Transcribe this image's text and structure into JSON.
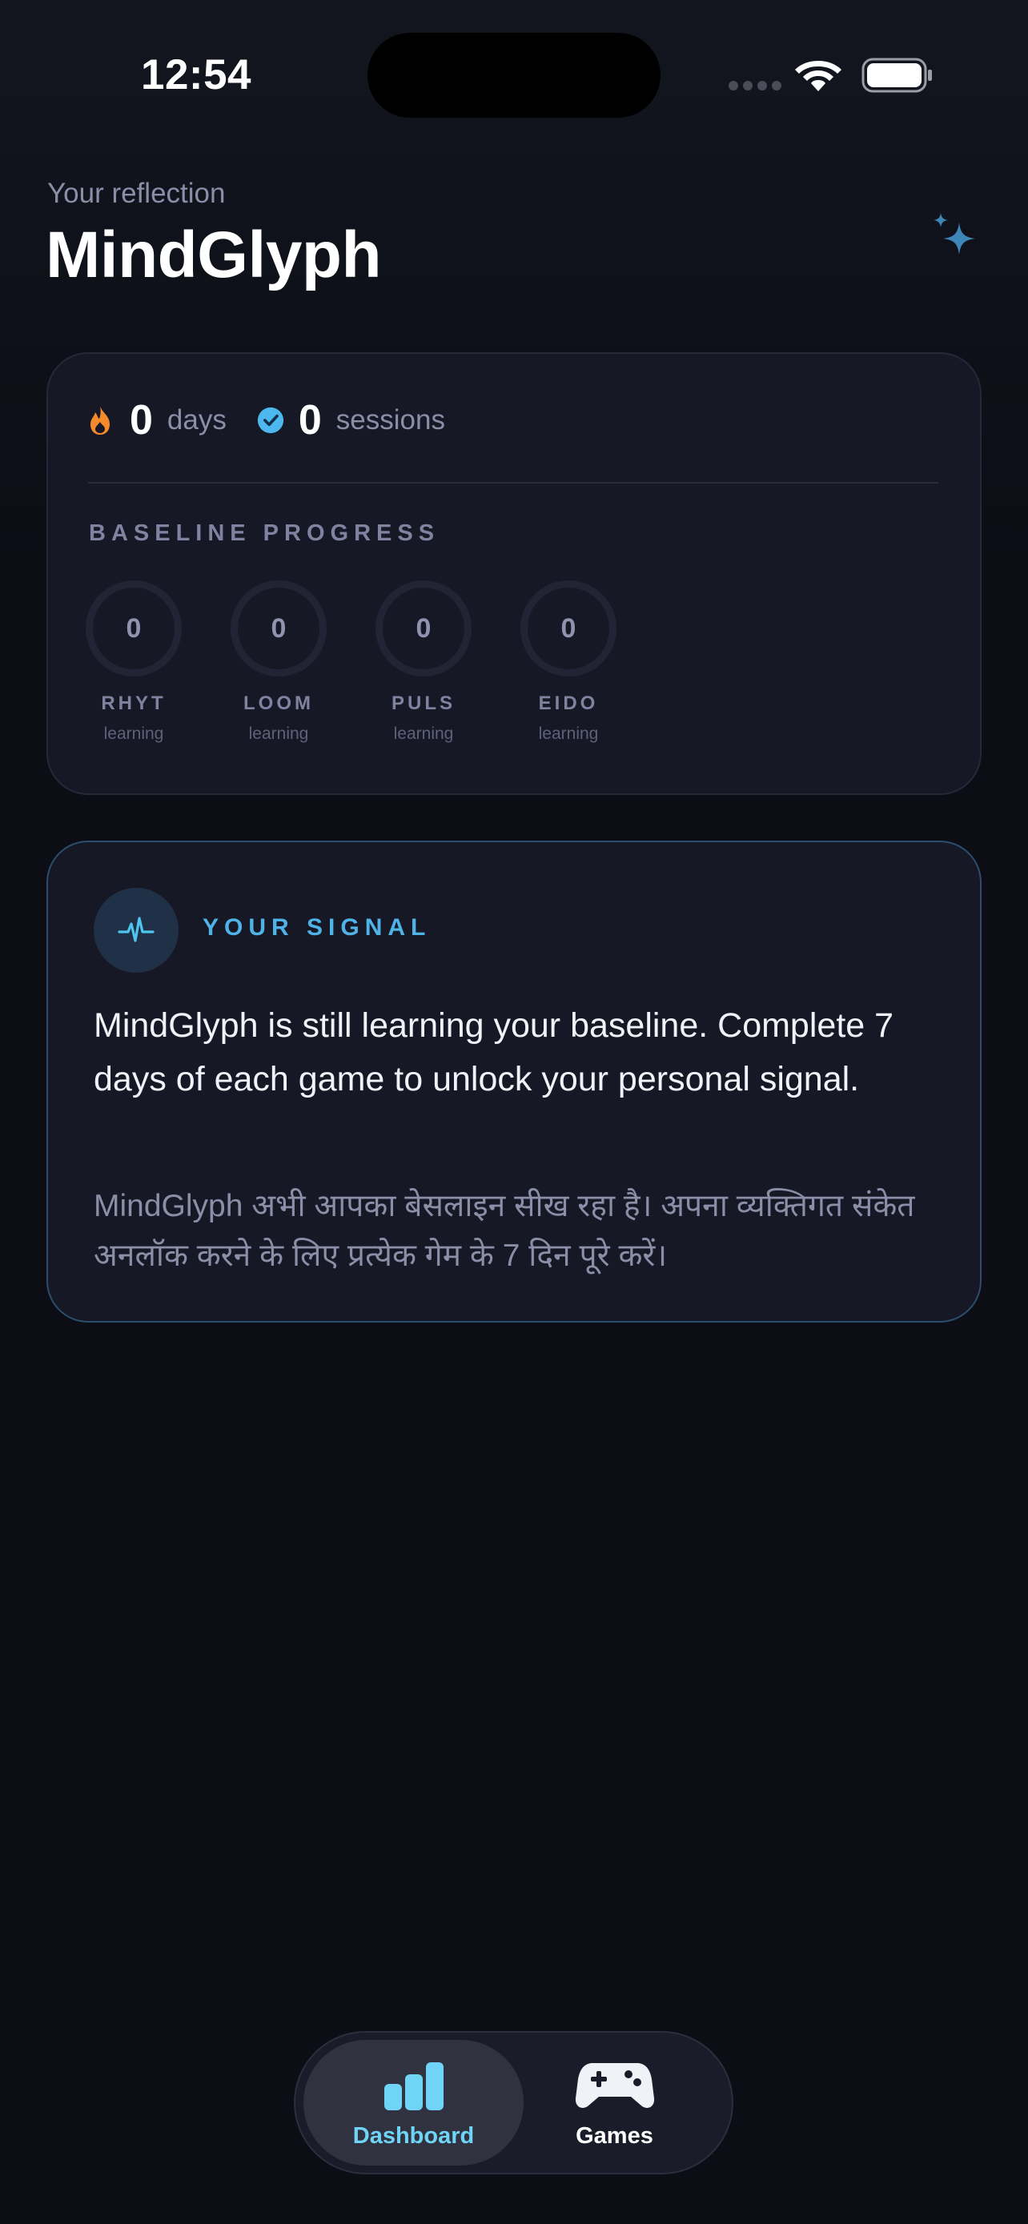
{
  "status_bar": {
    "time": "12:54"
  },
  "header": {
    "subtitle": "Your reflection",
    "title": "MindGlyph"
  },
  "stats": {
    "streak_value": "0",
    "streak_label": "days",
    "sessions_value": "0",
    "sessions_label": "sessions",
    "baseline_label": "BASELINE PROGRESS",
    "games": [
      {
        "code": "RHYT",
        "value": "0",
        "status": "learning"
      },
      {
        "code": "LOOM",
        "value": "0",
        "status": "learning"
      },
      {
        "code": "PULS",
        "value": "0",
        "status": "learning"
      },
      {
        "code": "EIDO",
        "value": "0",
        "status": "learning"
      }
    ]
  },
  "signal": {
    "label": "YOUR SIGNAL",
    "message_en": "MindGlyph is still learning your baseline. Complete 7 days of each game to unlock your personal signal.",
    "message_hi": "MindGlyph अभी आपका बेसलाइन सीख रहा है। अपना व्यक्तिगत संकेत अनलॉक करने के लिए प्रत्येक गेम के 7 दिन पूरे करें।"
  },
  "tab_bar": {
    "tabs": [
      {
        "label": "Dashboard",
        "icon": "bar-chart-icon",
        "active": true
      },
      {
        "label": "Games",
        "icon": "gamepad-icon",
        "active": false
      }
    ]
  },
  "colors": {
    "background": "#0c0d15",
    "card": "#171826",
    "accent_cyan": "#6fd4f6",
    "accent_blue": "#4fb3e8",
    "streak_orange": "#f58a2c",
    "session_blue": "#4cb8ee",
    "muted_text": "#8a8ea6"
  }
}
